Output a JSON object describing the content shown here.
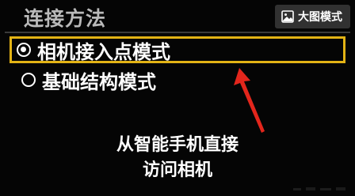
{
  "header": {
    "title": "连接方法"
  },
  "overlay": {
    "big_image_label": "大图模式",
    "big_image_icon": "image-icon"
  },
  "menu": {
    "items": [
      {
        "label": "相机接入点模式",
        "selected": true
      },
      {
        "label": "基础结构模式",
        "selected": false
      }
    ]
  },
  "description": {
    "line1": "从智能手机直接",
    "line2": "访问相机"
  },
  "colors": {
    "highlight": "#e3b315",
    "arrow": "#e3261c",
    "text": "#ffffff",
    "title": "#b9b9b9",
    "background": "#050505"
  }
}
